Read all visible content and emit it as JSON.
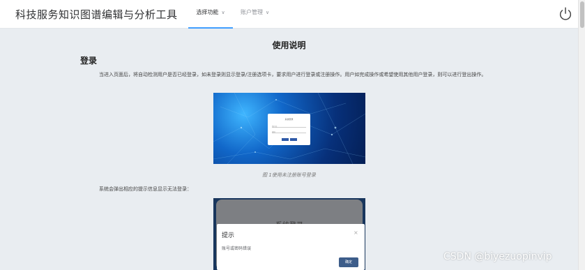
{
  "header": {
    "app_title": "科技服务知识图谱编辑与分析工具",
    "nav": [
      {
        "label": "选择功能",
        "active": true
      },
      {
        "label": "账户管理",
        "active": false
      }
    ],
    "power_icon": "power-icon"
  },
  "doc": {
    "title": "使用说明",
    "section_title": "登录",
    "paragraph": "当进入页面后，将自动检测用户是否已经登录，如未登录则显示登录/注册选项卡，要求用户进行登录或注册操作。用户如完成操作或希望使用其他用户登录，则可以进行登出操作。",
    "figure1": {
      "caption": "图 1使用未注册账号登录",
      "card_title": "系统登录",
      "field1": "用户名",
      "field2": "密码"
    },
    "paragraph2": "系统会弹出相应的提示信息显示无法登录：",
    "figure2": {
      "bg_title": "系统登录",
      "dialog_title": "提示",
      "dialog_message": "账号或密码错误",
      "dialog_ok": "确定",
      "dialog_close": "×"
    }
  },
  "watermark": "CSDN @biyezuopinvip",
  "colors": {
    "accent": "#409eff",
    "page_bg": "#e9edf1",
    "dialog_button": "#3d5d8a"
  }
}
